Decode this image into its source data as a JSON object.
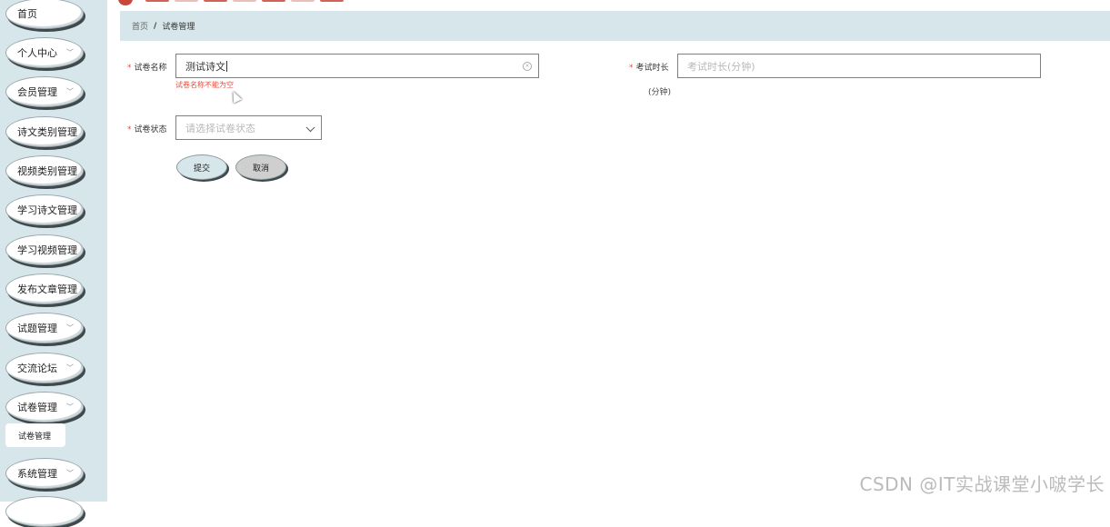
{
  "sidebar": {
    "items": [
      {
        "label": "首页",
        "chevron": false
      },
      {
        "label": "个人中心",
        "chevron": true
      },
      {
        "label": "会员管理",
        "chevron": true
      },
      {
        "label": "诗文类别管理",
        "chevron": false
      },
      {
        "label": "视频类别管理",
        "chevron": false
      },
      {
        "label": "学习诗文管理",
        "chevron": false
      },
      {
        "label": "学习视频管理",
        "chevron": false
      },
      {
        "label": "发布文章管理",
        "chevron": false
      },
      {
        "label": "试题管理",
        "chevron": true
      },
      {
        "label": "交流论坛",
        "chevron": true
      },
      {
        "label": "试卷管理",
        "chevron": true
      },
      {
        "label": "系统管理",
        "chevron": true
      }
    ],
    "submenu_label": "试卷管理",
    "chevron_glyph": "﹀"
  },
  "breadcrumb": {
    "home": "首页",
    "separator": "/",
    "current": "试卷管理"
  },
  "form": {
    "required_mark": "*",
    "paper_name": {
      "label": "试卷名称",
      "value": "测试诗文",
      "error": "试卷名称不能为空"
    },
    "exam_duration": {
      "label": "考试时长",
      "placeholder": "考试时长(分钟)",
      "unit_hint": "(分钟)"
    },
    "paper_status": {
      "label": "试卷状态",
      "placeholder": "请选择试卷状态"
    },
    "submit_label": "提交",
    "cancel_label": "取消"
  },
  "watermark": "CSDN @IT实战课堂小啵学长",
  "colors": {
    "sidebar_bg": "#d7e6ea",
    "required": "#e74c3c",
    "error": "#e74c3c",
    "logo": "#c9473a"
  }
}
